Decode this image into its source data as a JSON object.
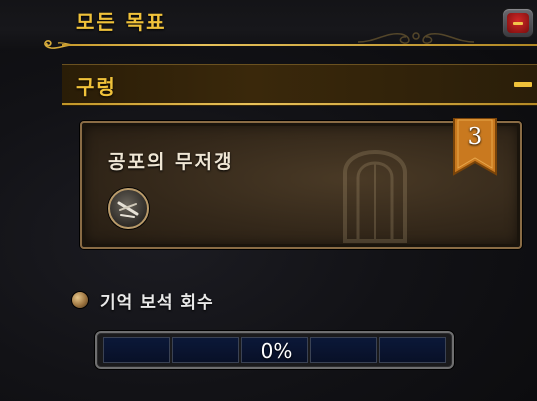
{
  "header": {
    "title": "모든 목표",
    "close_icon": "close-icon",
    "close_color": "#c0201f"
  },
  "section": {
    "title": "구렁",
    "collapse_icon": "minus-icon"
  },
  "quest": {
    "name": "공포의 무저갱",
    "rank": "3",
    "emblem_icon": "dungeon-emblem-icon",
    "rank_banner_color": "#c9791f"
  },
  "objective": {
    "label": "기억 보석 회수",
    "bullet_icon": "bronze-orb-icon",
    "progress_percent": 0,
    "progress_text": "0%",
    "segments": 5
  },
  "colors": {
    "gold_text": "#f0c23a",
    "gold_rule": "#e6c15a",
    "card_border": "#8a6c45",
    "progress_bg": "#0a1430"
  }
}
